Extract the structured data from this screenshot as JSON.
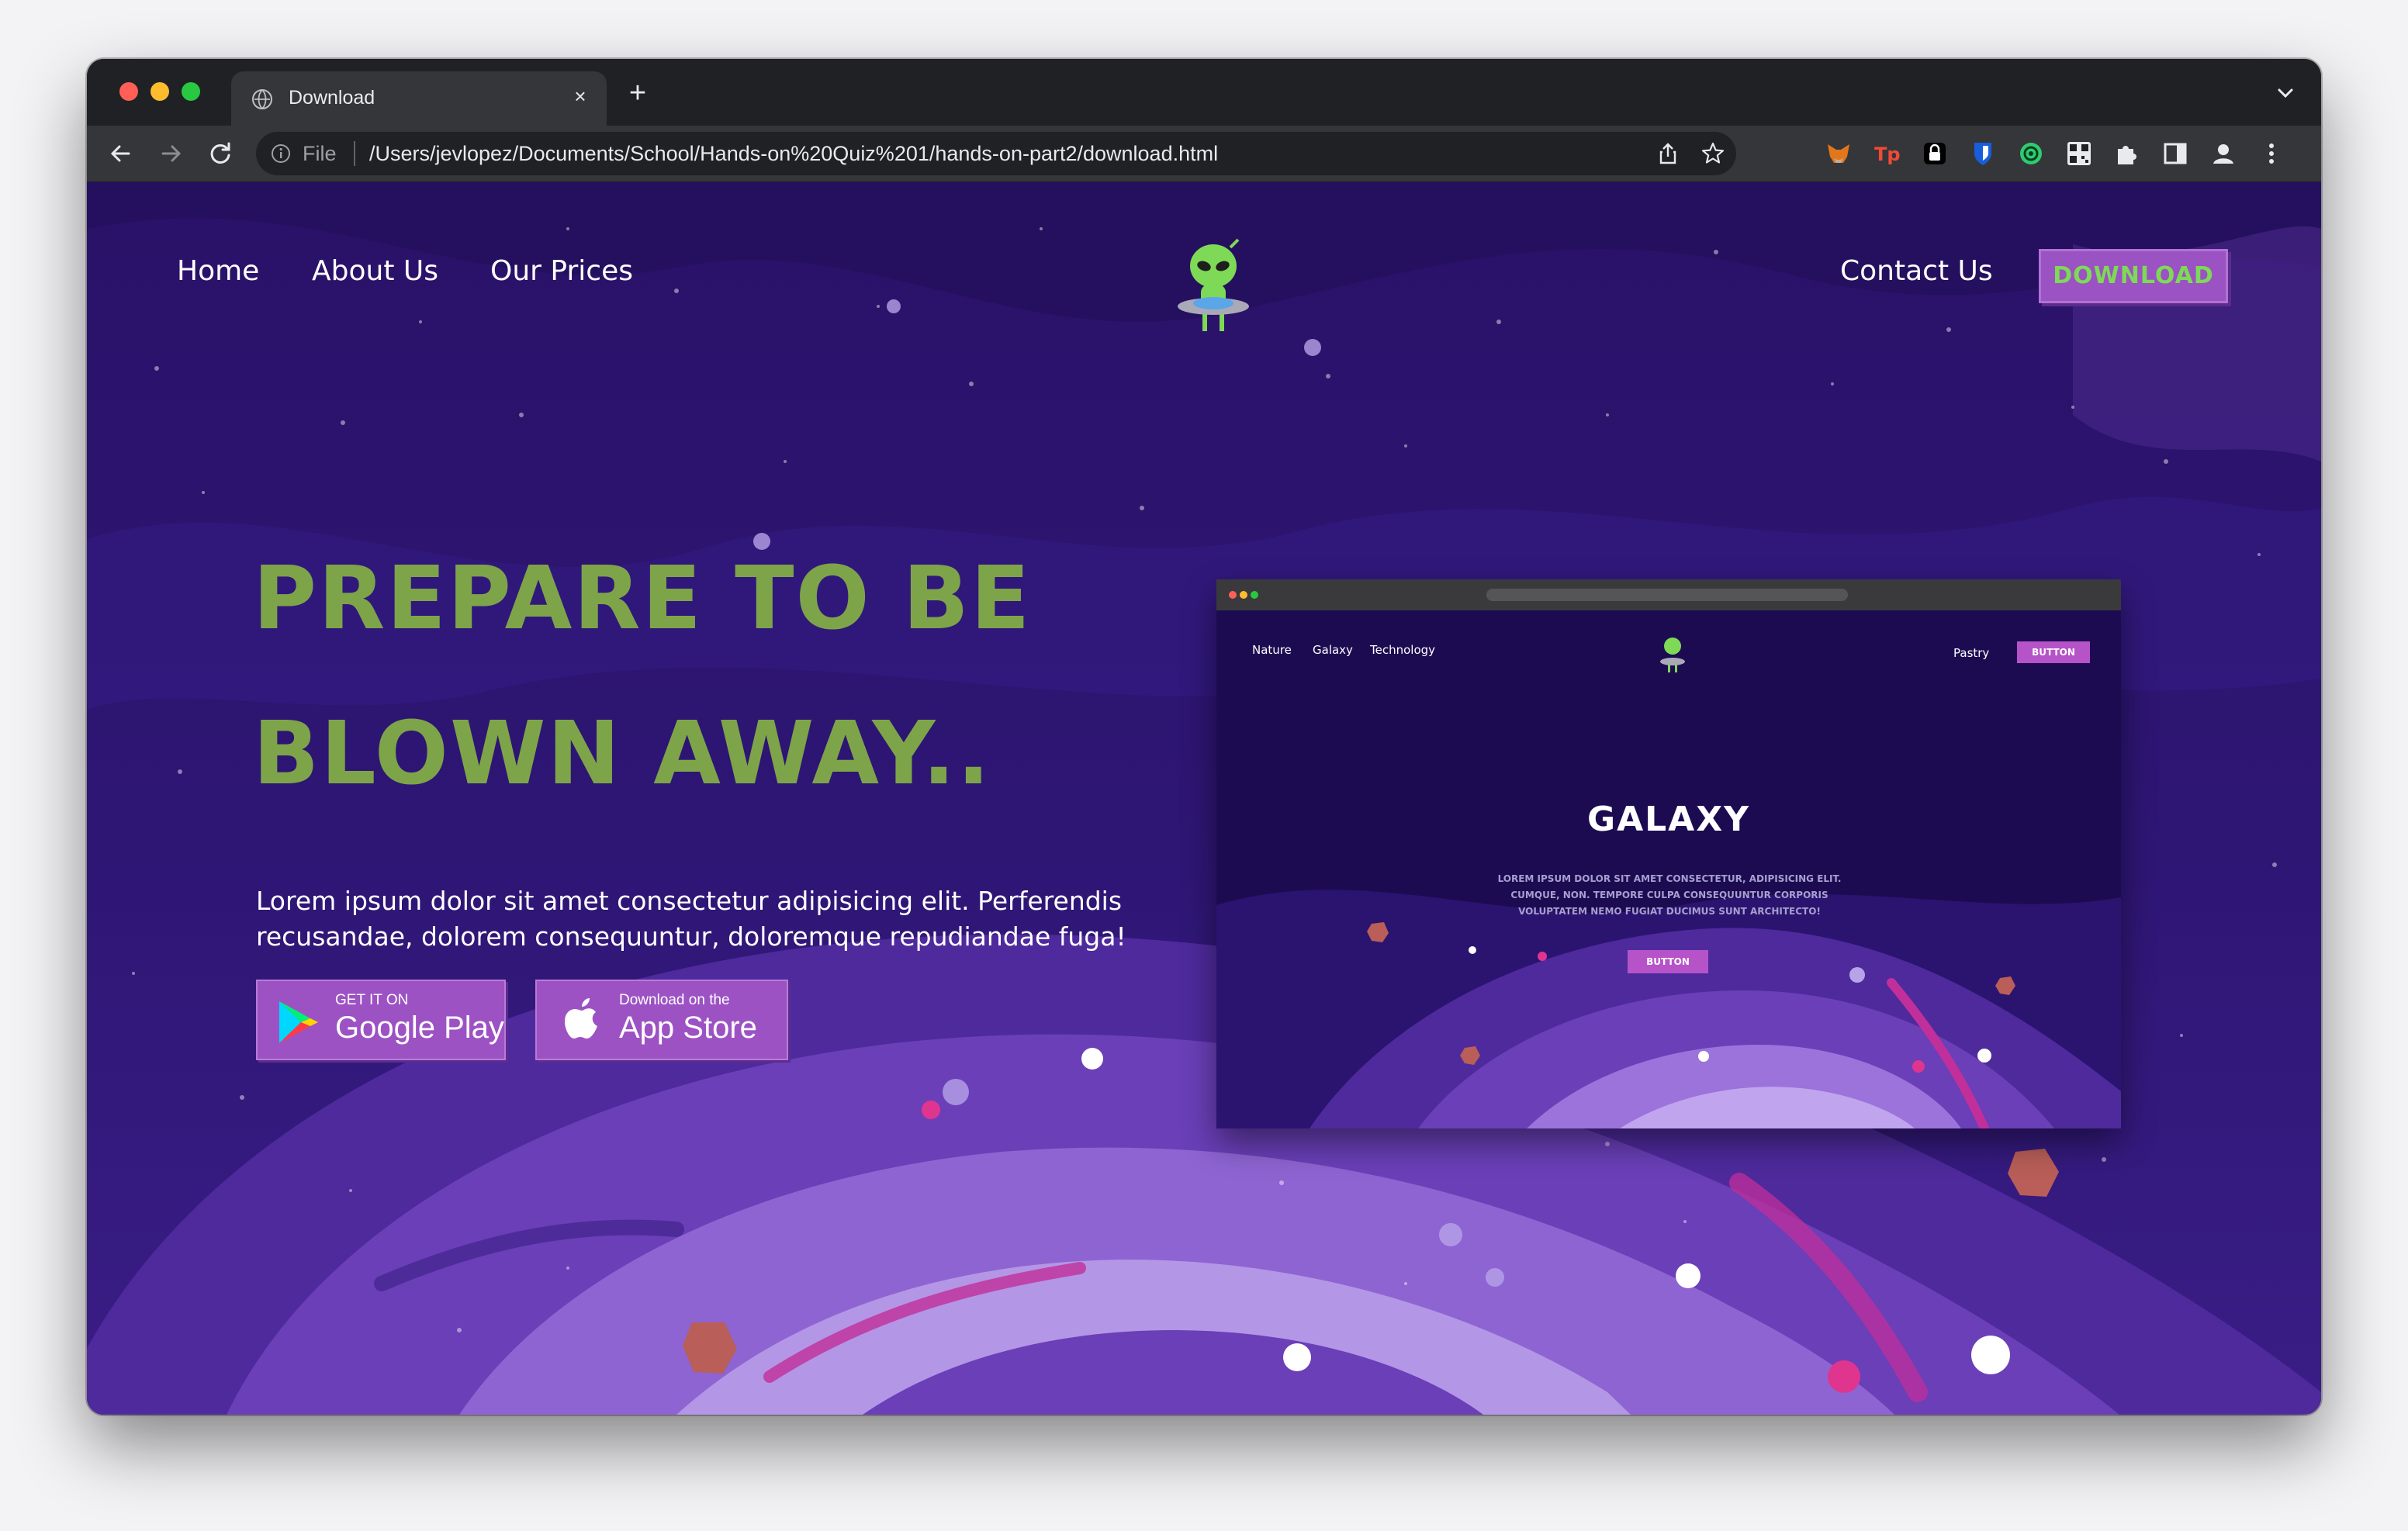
{
  "browser": {
    "tab_title": "Download",
    "new_tab_symbol": "+",
    "close_symbol": "×",
    "file_label": "File",
    "url": "/Users/jevlopez/Documents/School/Hands-on%20Quiz%201/hands-on-part2/download.html",
    "extensions": [
      "metamask-icon",
      "tp-icon",
      "lock-icon",
      "bitwarden-icon",
      "circle-extension-icon",
      "qr-code-icon",
      "puzzle-icon",
      "sidebar-icon",
      "profile-icon",
      "kebab-menu-icon"
    ]
  },
  "nav": {
    "home": "Home",
    "about": "About Us",
    "prices": "Our Prices",
    "contact": "Contact Us",
    "download": "DOWNLOAD"
  },
  "hero": {
    "title_line1": "PREPARE TO BE",
    "title_line2": "BLOWN AWAY..",
    "subtitle": "Lorem ipsum dolor sit amet consectetur adipisicing elit. Perferendis recusandae, dolorem consequuntur, doloremque repudiandae fuga!",
    "google_small": "GET IT ON",
    "google_big": "Google Play",
    "apple_small": "Download on the",
    "apple_big": "App Store"
  },
  "preview": {
    "nav_nature": "Nature",
    "nav_galaxy": "Galaxy",
    "nav_technology": "Technology",
    "nav_pastry": "Pastry",
    "nav_button": "BUTTON",
    "title": "GALAXY",
    "text": "LOREM IPSUM DOLOR SIT AMET CONSECTETUR, ADIPISICING ELIT. CUMQUE, NON. TEMPORE CULPA CONSEQUUNTUR CORPORIS VOLUPTATEM NEMO FUGIAT DUCIMUS SUNT ARCHITECTO!",
    "cta": "BUTTON"
  },
  "colors": {
    "accent_green": "#7ea449",
    "button_purple": "#9b52c3",
    "background": "#2a1470"
  }
}
